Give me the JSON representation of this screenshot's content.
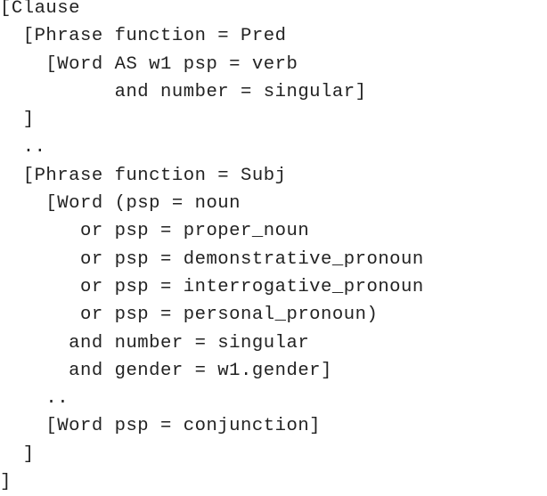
{
  "document": {
    "lines": [
      "[Clause",
      "  [Phrase function = Pred",
      "    [Word AS w1 psp = verb",
      "          and number = singular]",
      "  ]",
      "  ..",
      "  [Phrase function = Subj",
      "    [Word (psp = noun",
      "       or psp = proper_noun",
      "       or psp = demonstrative_pronoun",
      "       or psp = interrogative_pronoun",
      "       or psp = personal_pronoun)",
      "      and number = singular",
      "      and gender = w1.gender]",
      "    ..",
      "    [Word psp = conjunction]",
      "  ]",
      "]"
    ]
  }
}
